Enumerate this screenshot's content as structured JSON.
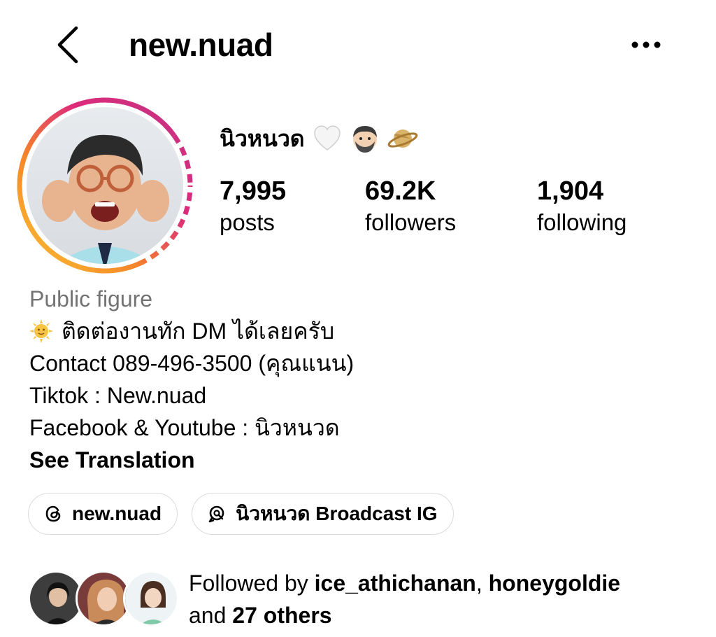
{
  "header": {
    "username": "new.nuad",
    "back_icon": "chevron-left-icon",
    "more_icon": "ellipsis-icon"
  },
  "profile": {
    "display_name": "นิวหนวด",
    "name_emojis": [
      "white-heart-icon",
      "man-beard-icon",
      "saturn-icon"
    ],
    "story_ring_colors": [
      "#f58529",
      "#dd2a7b",
      "#8134af"
    ],
    "stats": [
      {
        "value": "7,995",
        "label": "posts"
      },
      {
        "value": "69.2K",
        "label": "followers"
      },
      {
        "value": "1,904",
        "label": "following"
      }
    ]
  },
  "bio": {
    "category": "Public figure",
    "lines": [
      "ติดต่องานทัก DM ได้เลยครับ",
      "Contact 089-496-3500 (คุณแนน)",
      "Tiktok : New.nuad",
      "Facebook & Youtube : นิวหนวด"
    ],
    "line1_icon": "sun-face-icon",
    "see_translation": "See Translation"
  },
  "links": [
    {
      "icon": "threads-icon",
      "label": "new.nuad"
    },
    {
      "icon": "broadcast-channel-icon",
      "label": "นิวหนวด Broadcast IG"
    }
  ],
  "followed_by": {
    "prefix": "Followed by",
    "user1": "ice_athichanan",
    "separator": ",",
    "user2": "honeygoldie",
    "and_text": "and",
    "others": "27 others"
  }
}
